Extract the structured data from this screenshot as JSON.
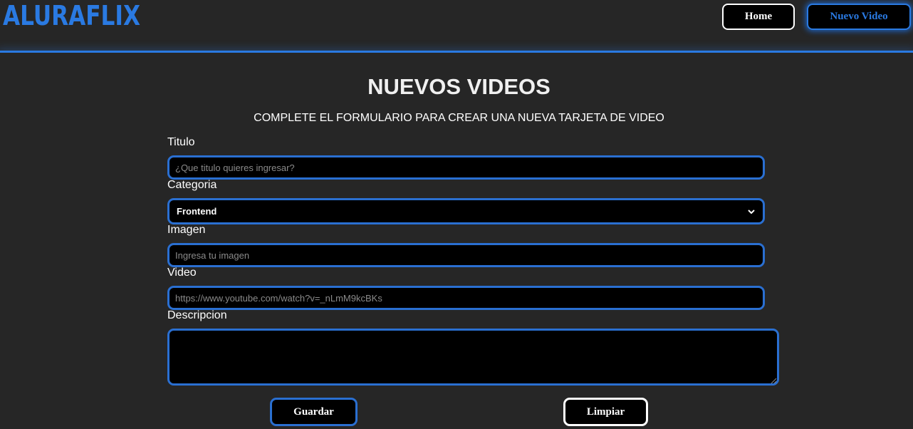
{
  "header": {
    "logo": "ALURAFLIX",
    "nav": {
      "home_label": "Home",
      "nuevo_video_label": "Nuevo Video"
    }
  },
  "main": {
    "title": "NUEVOS VIDEOS",
    "subtitle": "COMPLETE EL FORMULARIO PARA CREAR UNA NUEVA TARJETA DE VIDEO"
  },
  "form": {
    "titulo": {
      "label": "Titulo",
      "placeholder": "¿Que titulo quieres ingresar?",
      "value": ""
    },
    "categoria": {
      "label": "Categoria",
      "selected": "Frontend"
    },
    "imagen": {
      "label": "Imagen",
      "placeholder": "Ingresa tu imagen",
      "value": ""
    },
    "video": {
      "label": "Video",
      "placeholder": "https://www.youtube.com/watch?v=_nLmM9kcBKs",
      "value": ""
    },
    "descripcion": {
      "label": "Descripcion",
      "value": ""
    },
    "guardar_label": "Guardar",
    "limpiar_label": "Limpiar"
  },
  "colors": {
    "accent": "#2a7ae2",
    "background": "#262626",
    "field_background": "#000000"
  },
  "icons": [
    "chevron-down-icon",
    "resize-handle-icon"
  ]
}
